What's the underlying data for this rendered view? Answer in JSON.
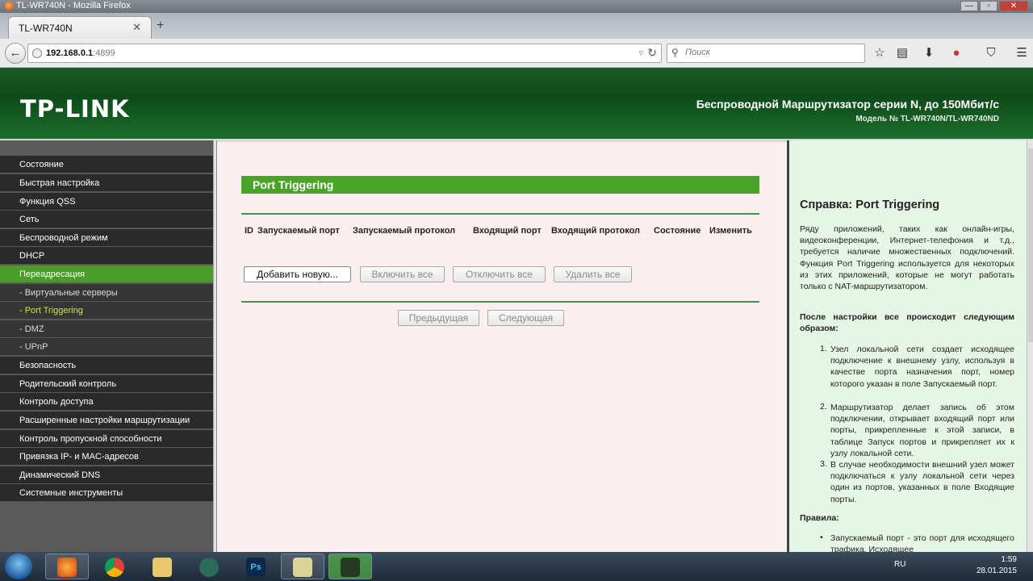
{
  "window": {
    "title": "TL-WR740N - Mozilla Firefox"
  },
  "browser": {
    "tab_title": "TL-WR740N",
    "url_host": "192.168.0.1",
    "url_port": ":4899",
    "search_placeholder": "Поиск"
  },
  "header": {
    "logo": "TP-LINK",
    "product": "Беспроводной Маршрутизатор серии N, до 150Мбит/с",
    "model": "Модель № TL-WR740N/TL-WR740ND"
  },
  "sidebar": {
    "items": [
      {
        "label": "Состояние"
      },
      {
        "label": "Быстрая настройка"
      },
      {
        "label": "Функция QSS"
      },
      {
        "label": "Сеть"
      },
      {
        "label": "Беспроводной режим"
      },
      {
        "label": "DHCP"
      },
      {
        "label": "Переадресация"
      },
      {
        "label": "- Виртуальные серверы"
      },
      {
        "label": "- Port Triggering"
      },
      {
        "label": "- DMZ"
      },
      {
        "label": "- UPnP"
      },
      {
        "label": "Безопасность"
      },
      {
        "label": "Родительский контроль"
      },
      {
        "label": "Контроль доступа"
      },
      {
        "label": "Расширенные настройки маршрутизации"
      },
      {
        "label": "Контроль пропускной способности"
      },
      {
        "label": "Привязка IP- и MAC-адресов"
      },
      {
        "label": "Динамический DNS"
      },
      {
        "label": "Системные инструменты"
      }
    ]
  },
  "main": {
    "title": "Port Triggering",
    "columns": [
      "ID",
      "Запускаемый порт",
      "Запускаемый протокол",
      "Входящий порт",
      "Входящий протокол",
      "Состояние",
      "Изменить"
    ],
    "buttons": {
      "add": "Добавить новую...",
      "enable_all": "Включить все",
      "disable_all": "Отключить все",
      "delete_all": "Удалить все",
      "prev": "Предыдущая",
      "next": "Следующая"
    }
  },
  "help": {
    "title": "Справка: Port Triggering",
    "intro": "Ряду приложений, таких как онлайн-игры, видеоконференции, Интернет-телефония и т.д., требуется наличие множественных подключений. Функция Port Triggering используется для некоторых из этих приложений, которые не могут работать только с NAT-маршрутизатором.",
    "after": "После настройки все происходит следующим образом:",
    "steps": [
      "Узел локальной сети создает исходящее подключение к внешнему узлу, используя в качестве порта назначения порт, номер которого указан в поле Запускаемый порт.",
      "Маршрутизатор делает запись об этом подключении, открывает входящий порт или порты, прикрепленные к этой записи, в таблице Запуск портов и прикрепляет их к узлу локальной сети.",
      "В случае необходимости внешний узел может подключаться к узлу локальной сети через один из портов, указанных в поле Входящие порты."
    ],
    "rules_label": "Правила:",
    "rule1": "Запускаемый порт - это порт для исходящего трафика. Исходящее"
  },
  "taskbar": {
    "lang": "RU",
    "time": "1:59",
    "date": "28.01.2015"
  }
}
